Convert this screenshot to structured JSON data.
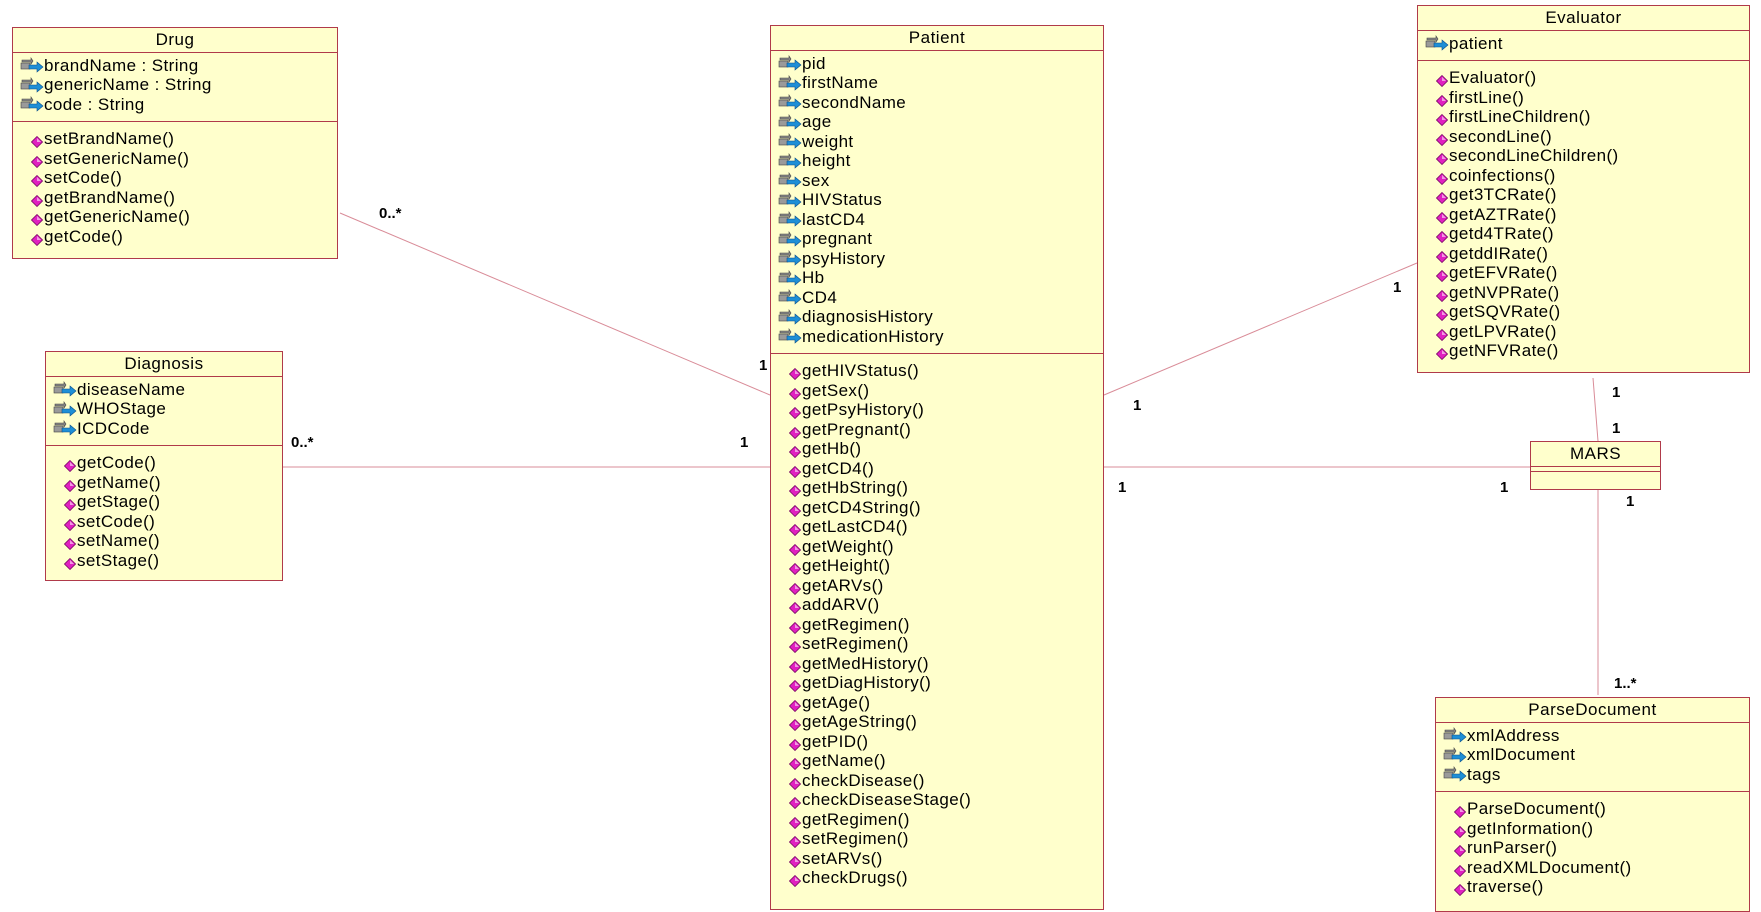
{
  "classes": {
    "drug": {
      "name": "Drug",
      "attributes": [
        "brandName : String",
        "genericName : String",
        "code : String"
      ],
      "operations": [
        "setBrandName()",
        "setGenericName()",
        "setCode()",
        "getBrandName()",
        "getGenericName()",
        "getCode()"
      ]
    },
    "diagnosis": {
      "name": "Diagnosis",
      "attributes": [
        "diseaseName",
        "WHOStage",
        "ICDCode"
      ],
      "operations": [
        "getCode()",
        "getName()",
        "getStage()",
        "setCode()",
        "setName()",
        "setStage()"
      ]
    },
    "patient": {
      "name": "Patient",
      "attributes": [
        "pid",
        "firstName",
        "secondName",
        "age",
        "weight",
        "height",
        "sex",
        "HIVStatus",
        "lastCD4",
        "pregnant",
        "psyHistory",
        "Hb",
        "CD4",
        "diagnosisHistory",
        "medicationHistory"
      ],
      "operations": [
        "getHIVStatus()",
        "getSex()",
        "getPsyHistory()",
        "getPregnant()",
        "getHb()",
        "getCD4()",
        "getHbString()",
        "getCD4String()",
        "getLastCD4()",
        "getWeight()",
        "getHeight()",
        "getARVs()",
        "addARV()",
        "getRegimen()",
        "setRegimen()",
        "getMedHistory()",
        "getDiagHistory()",
        "getAge()",
        "getAgeString()",
        "getPID()",
        "getName()",
        "checkDisease()",
        "checkDiseaseStage()",
        "getRegimen()",
        "setRegimen()",
        "setARVs()",
        "checkDrugs()"
      ]
    },
    "evaluator": {
      "name": "Evaluator",
      "attributes": [
        "patient"
      ],
      "operations": [
        "Evaluator()",
        "firstLine()",
        "firstLineChildren()",
        "secondLine()",
        "secondLineChildren()",
        "coinfections()",
        "get3TCRate()",
        "getAZTRate()",
        "getd4TRate()",
        "getddIRate()",
        "getEFVRate()",
        "getNVPRate()",
        "getSQVRate()",
        "getLPVRate()",
        "getNFVRate()"
      ]
    },
    "mars": {
      "name": "MARS",
      "attributes": [],
      "operations": []
    },
    "parsedocument": {
      "name": "ParseDocument",
      "attributes": [
        "xmlAddress",
        "xmlDocument",
        "tags"
      ],
      "operations": [
        "ParseDocument()",
        "getInformation()",
        "runParser()",
        "readXMLDocument()",
        "traverse()"
      ]
    }
  },
  "multiplicities": {
    "drug_end": "0..*",
    "drug_patient_end": "1",
    "diagnosis_end": "0..*",
    "diagnosis_patient_end": "1",
    "patient_evaluator_end": "1",
    "evaluator_end": "1",
    "patient_mars_end": "1",
    "mars_patient_end": "1",
    "evaluator_mars_end": "1",
    "mars_evaluator_end": "1",
    "mars_parse_end": "1",
    "parse_end": "1..*"
  },
  "colors": {
    "class_fill": "#ffffcc",
    "class_border": "#b03a4a",
    "association_line": "#d98c98",
    "attribute_icon": "#1e8fd6",
    "operation_icon": "#e020c0"
  }
}
